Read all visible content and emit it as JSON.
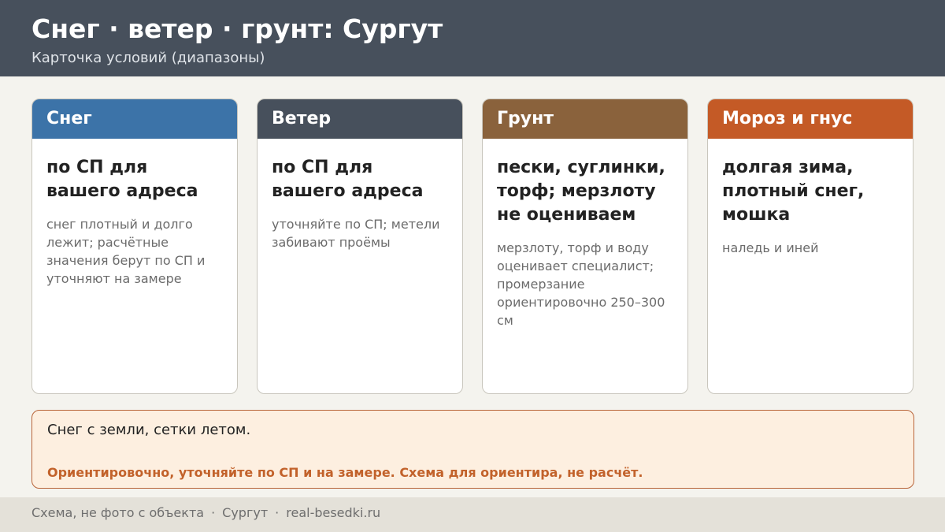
{
  "header": {
    "title": "Снег · ветер · грунт: Сургут",
    "subtitle": "Карточка условий (диапазоны)"
  },
  "cards": [
    {
      "heading": "Снег",
      "color": "#3c73a8",
      "main": "по СП для вашего адреса",
      "note": "снег плотный и долго лежит; расчётные значения берут по СП и уточняют на замере"
    },
    {
      "heading": "Ветер",
      "color": "#47505c",
      "main": "по СП для вашего адреса",
      "note": "уточняйте по СП; метели забивают проёмы"
    },
    {
      "heading": "Грунт",
      "color": "#8a623c",
      "main": "пески, суглинки, торф; мерзлоту не оцениваем",
      "note": "мерзлоту, торф и воду оценивает специалист; промерзание ориентировочно 250–300 см"
    },
    {
      "heading": "Мороз и гнус",
      "color": "#c45a26",
      "main": "долгая зима, плотный снег, мошка",
      "note": "наледь и иней"
    }
  ],
  "notice": {
    "text": "Снег с земли, сетки летом.",
    "warning": "Ориентировочно, уточняйте по СП и на замере. Схема для ориентира, не расчёт."
  },
  "footer": {
    "items": [
      "Схема, не фото с объекта",
      "Сургут",
      "real-besedki.ru"
    ],
    "separator": "·"
  }
}
